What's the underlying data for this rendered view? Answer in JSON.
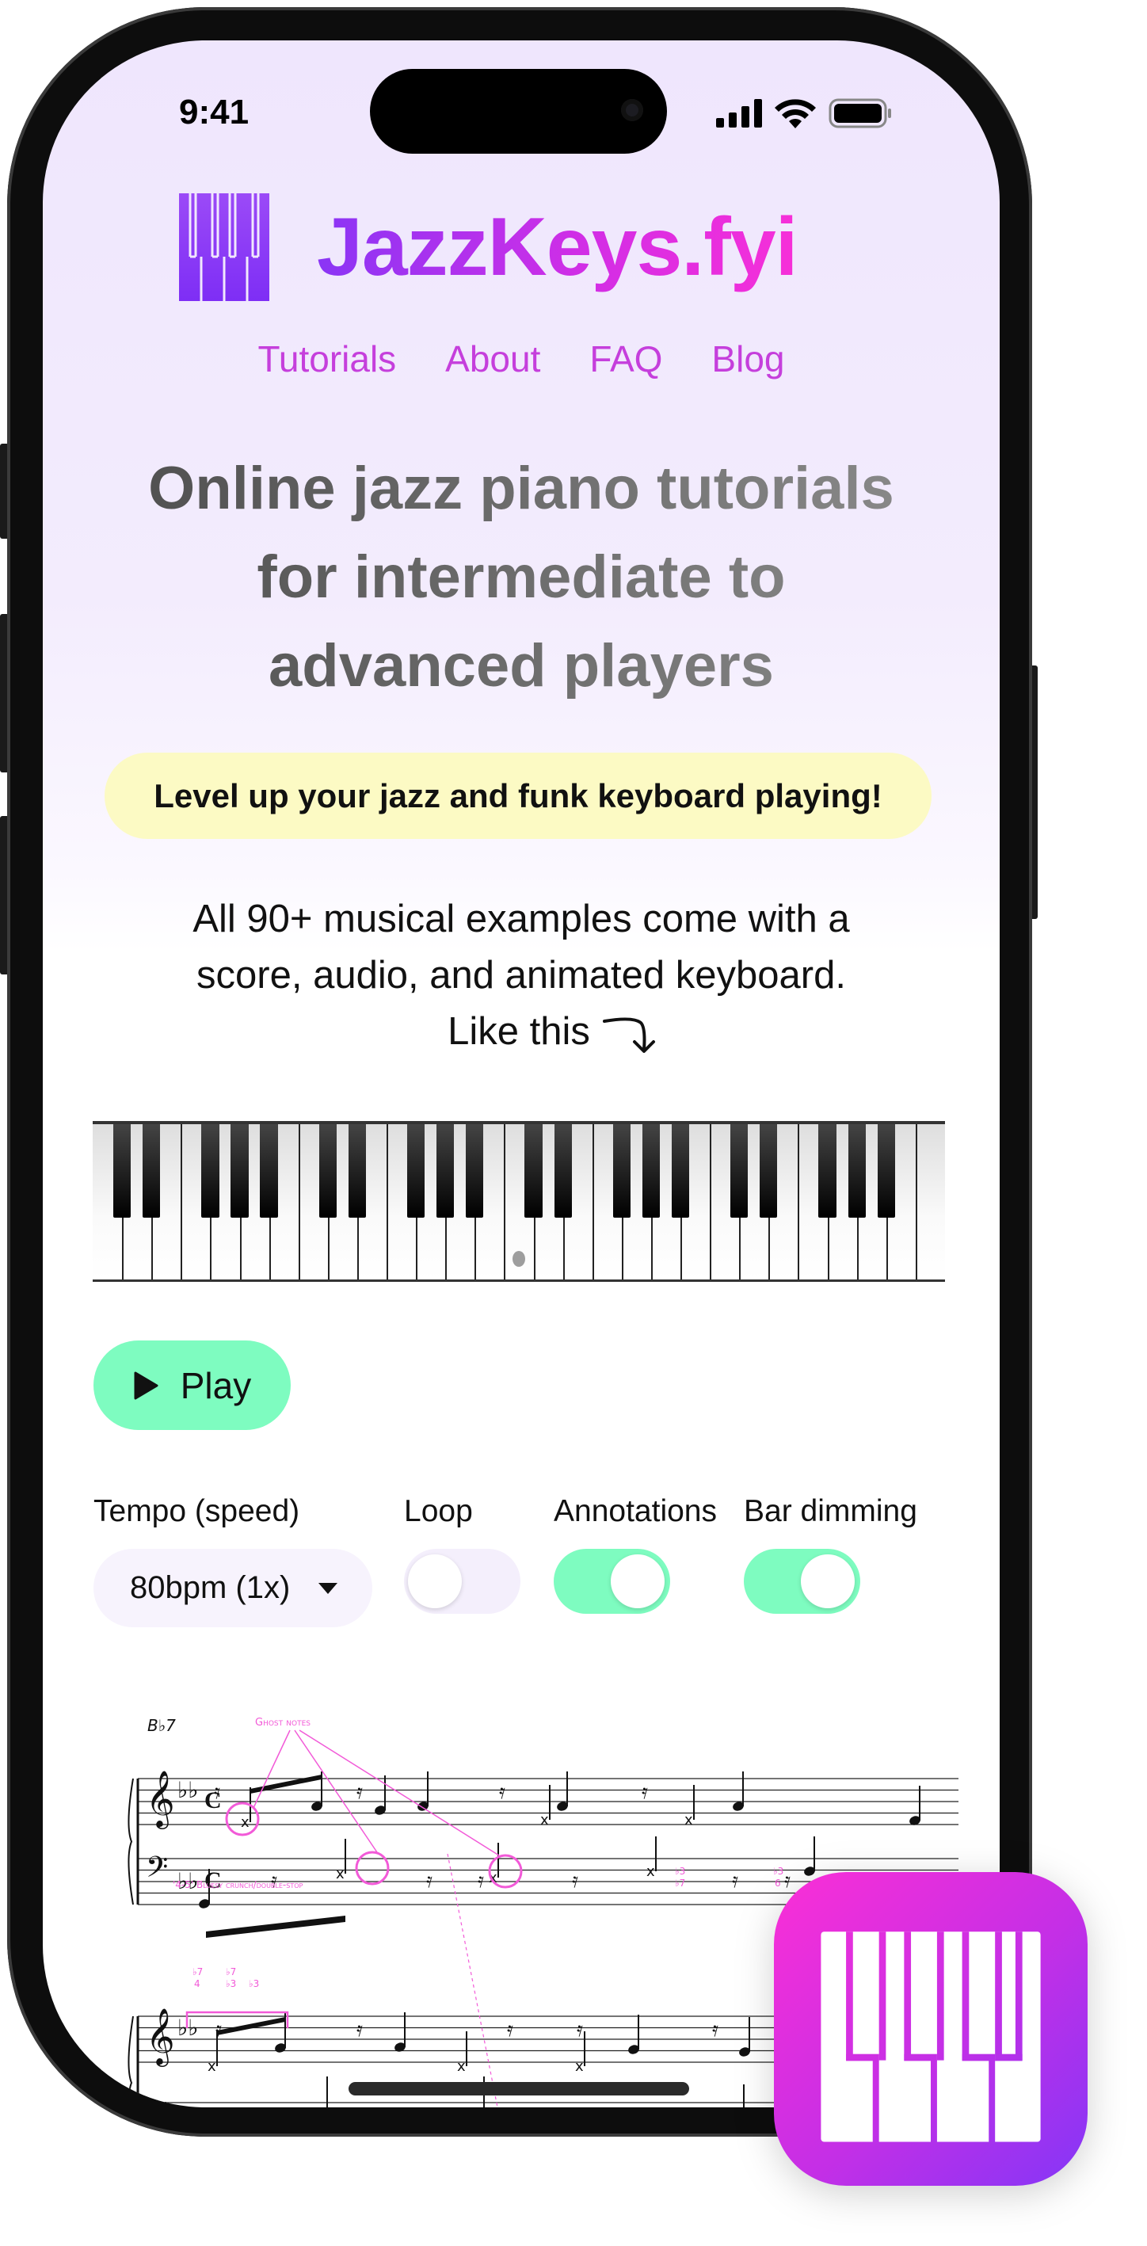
{
  "status_bar": {
    "time": "9:41",
    "icons": [
      "cellular-signal-icon",
      "wifi-icon",
      "battery-icon"
    ]
  },
  "brand": {
    "name": "JazzKeys.fyi",
    "colors": {
      "purple": "#8a35f5",
      "pink": "#f72fd8"
    }
  },
  "nav": {
    "items": [
      {
        "label": "Tutorials"
      },
      {
        "label": "About"
      },
      {
        "label": "FAQ"
      },
      {
        "label": "Blog"
      }
    ]
  },
  "hero": {
    "headline_lines": [
      "Online jazz piano tutorials",
      "for intermediate to",
      "advanced players"
    ],
    "tagline": "Level up your jazz and funk keyboard playing!",
    "intro_lines": [
      "All 90+ musical examples come with a",
      "score, audio, and animated keyboard.",
      "Like this"
    ]
  },
  "keyboard": {
    "white_keys": 29,
    "first_key": "C",
    "marker_key_index": 14
  },
  "player": {
    "play_label": "Play",
    "tempo": {
      "label": "Tempo (speed)",
      "value": "80bpm (1x)"
    },
    "toggles": [
      {
        "label": "Loop",
        "on": false
      },
      {
        "label": "Annotations",
        "on": true
      },
      {
        "label": "Bar dimming",
        "on": true
      }
    ],
    "accent": "#7efcc0"
  },
  "score": {
    "chord_symbol": "B♭7",
    "annotations": {
      "ghost_notes": "Ghost notes",
      "crunch": "'4-5' Bluesy crunch/double-stop",
      "interval_1": [
        "♭7",
        "4"
      ],
      "interval_2": [
        "♭7",
        "♭3"
      ],
      "interval_3": [
        "♭3"
      ],
      "interval_4": [
        "♭3",
        "♭7"
      ],
      "interval_5": [
        "♭3",
        "6"
      ]
    },
    "annotation_color": "#f25ad8"
  }
}
